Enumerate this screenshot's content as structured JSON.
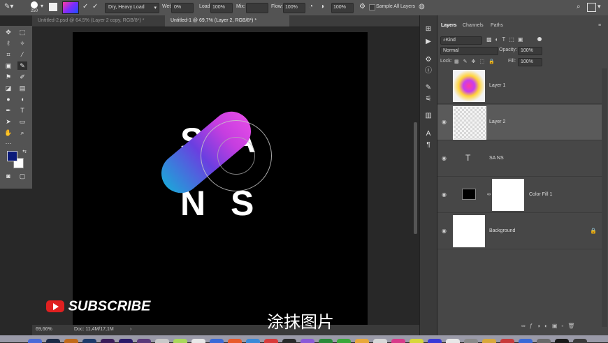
{
  "options_bar": {
    "brush_size": "250",
    "blend_preset": "Dry, Heavy Load",
    "wet_label": "Wet:",
    "wet_value": "0%",
    "load_label": "Load:",
    "load_value": "100%",
    "mix_label": "Mix:",
    "flow_label": "Flow:",
    "flow_value": "100%",
    "opacity_value": "100%",
    "sample_all_layers": "Sample All Layers"
  },
  "tabs": [
    {
      "label": "Untitled-2.psd @ 64,5% (Layer 2 copy, RGB/8*) *"
    },
    {
      "label": "Untitled-1 @ 69,7% (Layer 2, RGB/8*) *"
    }
  ],
  "canvas": {
    "letters": [
      "S",
      "A",
      "N",
      "S"
    ]
  },
  "status": {
    "zoom": "69,66%",
    "doc": "Doc: 11,4M/17,1M"
  },
  "layers_panel": {
    "tabs": [
      "Layers",
      "Channels",
      "Paths"
    ],
    "kind": "Kind",
    "blend_mode": "Normal",
    "opacity_label": "Opacity:",
    "opacity_value": "100%",
    "lock_label": "Lock:",
    "fill_label": "Fill:",
    "fill_value": "100%",
    "layers": [
      {
        "name": "Layer 1"
      },
      {
        "name": "Layer 2"
      },
      {
        "name": "SA NS"
      },
      {
        "name": "Color Fill 1"
      },
      {
        "name": "Background"
      }
    ]
  },
  "overlay": {
    "subscribe": "SUBSCRIBE",
    "caption": "涂抹图片"
  },
  "colors": {
    "foreground": "#0b1a7a",
    "background": "#ffffff",
    "stroke_start": "#1fa3d9",
    "stroke_end": "#e24be6"
  }
}
